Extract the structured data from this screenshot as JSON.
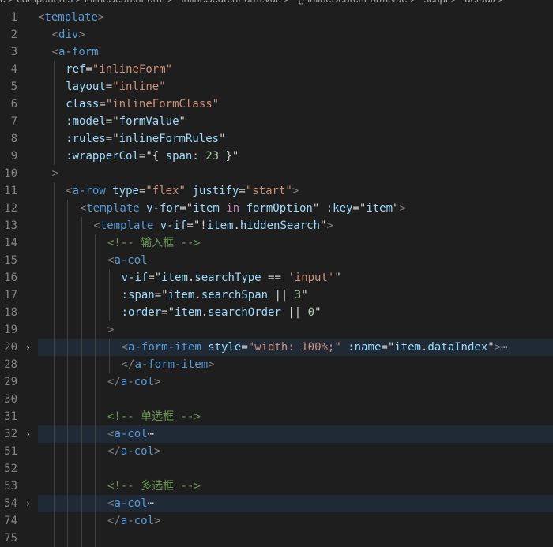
{
  "breadcrumb": [
    "c > components > inlineSearchForm > ",
    "inlineSearchForm.vue > ",
    "{} inlineSearchForm.vue > ",
    "script > ",
    "default > "
  ],
  "lines": [
    {
      "n": "1",
      "indent": 0,
      "fold": "",
      "hl": false,
      "tokens": [
        [
          "t",
          "<"
        ],
        [
          "tag",
          "template"
        ],
        [
          "t",
          ">"
        ]
      ]
    },
    {
      "n": "2",
      "indent": 1,
      "fold": "",
      "hl": false,
      "tokens": [
        [
          "t",
          "<"
        ],
        [
          "tag",
          "div"
        ],
        [
          "t",
          ">"
        ]
      ]
    },
    {
      "n": "3",
      "indent": 1,
      "fold": "",
      "hl": false,
      "tokens": [
        [
          "t",
          "<"
        ],
        [
          "tag",
          "a-form"
        ]
      ]
    },
    {
      "n": "4",
      "indent": 2,
      "fold": "",
      "hl": false,
      "tokens": [
        [
          "attr",
          "ref"
        ],
        [
          "d",
          "="
        ],
        [
          "str",
          "\"inlineForm\""
        ]
      ]
    },
    {
      "n": "5",
      "indent": 2,
      "fold": "",
      "hl": false,
      "tokens": [
        [
          "attr",
          "layout"
        ],
        [
          "d",
          "="
        ],
        [
          "str",
          "\"inline\""
        ]
      ]
    },
    {
      "n": "6",
      "indent": 2,
      "fold": "",
      "hl": false,
      "tokens": [
        [
          "attr",
          "class"
        ],
        [
          "d",
          "="
        ],
        [
          "str",
          "\"inlineFormClass\""
        ]
      ]
    },
    {
      "n": "7",
      "indent": 2,
      "fold": "",
      "hl": false,
      "tokens": [
        [
          "attr",
          ":model"
        ],
        [
          "d",
          "="
        ],
        [
          "d",
          "\""
        ],
        [
          "attr",
          "formValue"
        ],
        [
          "d",
          "\""
        ]
      ]
    },
    {
      "n": "8",
      "indent": 2,
      "fold": "",
      "hl": false,
      "tokens": [
        [
          "attr",
          ":rules"
        ],
        [
          "d",
          "="
        ],
        [
          "d",
          "\""
        ],
        [
          "attr",
          "inlineFormRules"
        ],
        [
          "d",
          "\""
        ]
      ]
    },
    {
      "n": "9",
      "indent": 2,
      "fold": "",
      "hl": false,
      "tokens": [
        [
          "attr",
          ":wrapperCol"
        ],
        [
          "d",
          "="
        ],
        [
          "d",
          "\"{ "
        ],
        [
          "attr",
          "span"
        ],
        [
          "d",
          ": "
        ],
        [
          "num",
          "23"
        ],
        [
          "d",
          " }\""
        ]
      ]
    },
    {
      "n": "10",
      "indent": 1,
      "fold": "",
      "hl": false,
      "tokens": [
        [
          "t",
          ">"
        ]
      ]
    },
    {
      "n": "11",
      "indent": 2,
      "fold": "",
      "hl": false,
      "tokens": [
        [
          "t",
          "<"
        ],
        [
          "tag",
          "a-row"
        ],
        [
          "d",
          " "
        ],
        [
          "attr",
          "type"
        ],
        [
          "d",
          "="
        ],
        [
          "str",
          "\"flex\""
        ],
        [
          "d",
          " "
        ],
        [
          "attr",
          "justify"
        ],
        [
          "d",
          "="
        ],
        [
          "str",
          "\"start\""
        ],
        [
          "t",
          ">"
        ]
      ]
    },
    {
      "n": "12",
      "indent": 3,
      "fold": "",
      "hl": false,
      "tokens": [
        [
          "t",
          "<"
        ],
        [
          "tag",
          "template"
        ],
        [
          "d",
          " "
        ],
        [
          "attr",
          "v-for"
        ],
        [
          "d",
          "=\""
        ],
        [
          "attr",
          "item"
        ],
        [
          "d",
          " "
        ],
        [
          "kw",
          "in"
        ],
        [
          "d",
          " "
        ],
        [
          "attr",
          "formOption"
        ],
        [
          "d",
          "\" "
        ],
        [
          "attr",
          ":key"
        ],
        [
          "d",
          "=\""
        ],
        [
          "attr",
          "item"
        ],
        [
          "d",
          "\""
        ],
        [
          "t",
          ">"
        ]
      ]
    },
    {
      "n": "13",
      "indent": 4,
      "fold": "",
      "hl": false,
      "tokens": [
        [
          "t",
          "<"
        ],
        [
          "tag",
          "template"
        ],
        [
          "d",
          " "
        ],
        [
          "attr",
          "v-if"
        ],
        [
          "d",
          "=\"!"
        ],
        [
          "attr",
          "item"
        ],
        [
          "d",
          "."
        ],
        [
          "attr",
          "hiddenSearch"
        ],
        [
          "d",
          "\""
        ],
        [
          "t",
          ">"
        ]
      ]
    },
    {
      "n": "14",
      "indent": 5,
      "fold": "",
      "hl": false,
      "tokens": [
        [
          "cm",
          "<!-- 输入框 -->"
        ]
      ]
    },
    {
      "n": "15",
      "indent": 5,
      "fold": "",
      "hl": false,
      "tokens": [
        [
          "t",
          "<"
        ],
        [
          "tag",
          "a-col"
        ]
      ]
    },
    {
      "n": "16",
      "indent": 6,
      "fold": "",
      "hl": false,
      "tokens": [
        [
          "attr",
          "v-if"
        ],
        [
          "d",
          "=\""
        ],
        [
          "attr",
          "item"
        ],
        [
          "d",
          "."
        ],
        [
          "attr",
          "searchType"
        ],
        [
          "d",
          " == "
        ],
        [
          "str",
          "'input'"
        ],
        [
          "d",
          "\""
        ]
      ]
    },
    {
      "n": "17",
      "indent": 6,
      "fold": "",
      "hl": false,
      "tokens": [
        [
          "attr",
          ":span"
        ],
        [
          "d",
          "=\""
        ],
        [
          "attr",
          "item"
        ],
        [
          "d",
          "."
        ],
        [
          "attr",
          "searchSpan"
        ],
        [
          "d",
          " || "
        ],
        [
          "num",
          "3"
        ],
        [
          "d",
          "\""
        ]
      ]
    },
    {
      "n": "18",
      "indent": 6,
      "fold": "",
      "hl": false,
      "tokens": [
        [
          "attr",
          ":order"
        ],
        [
          "d",
          "=\""
        ],
        [
          "attr",
          "item"
        ],
        [
          "d",
          "."
        ],
        [
          "attr",
          "searchOrder"
        ],
        [
          "d",
          " || "
        ],
        [
          "num",
          "0"
        ],
        [
          "d",
          "\""
        ]
      ]
    },
    {
      "n": "19",
      "indent": 5,
      "fold": "",
      "hl": false,
      "tokens": [
        [
          "t",
          ">"
        ]
      ]
    },
    {
      "n": "20",
      "indent": 6,
      "fold": "›",
      "hl": true,
      "tokens": [
        [
          "t",
          "<"
        ],
        [
          "tag",
          "a-form-item"
        ],
        [
          "d",
          " "
        ],
        [
          "attr",
          "style"
        ],
        [
          "d",
          "="
        ],
        [
          "str",
          "\"width: 100%;\""
        ],
        [
          "d",
          " "
        ],
        [
          "attr",
          ":name"
        ],
        [
          "d",
          "=\""
        ],
        [
          "attr",
          "item"
        ],
        [
          "d",
          "."
        ],
        [
          "attr",
          "dataIndex"
        ],
        [
          "d",
          "\""
        ],
        [
          "t",
          ">"
        ],
        [
          "ell",
          "⋯"
        ]
      ]
    },
    {
      "n": "28",
      "indent": 6,
      "fold": "",
      "hl": false,
      "tokens": [
        [
          "t",
          "</"
        ],
        [
          "tag",
          "a-form-item"
        ],
        [
          "t",
          ">"
        ]
      ]
    },
    {
      "n": "29",
      "indent": 5,
      "fold": "",
      "hl": false,
      "tokens": [
        [
          "t",
          "</"
        ],
        [
          "tag",
          "a-col"
        ],
        [
          "t",
          ">"
        ]
      ]
    },
    {
      "n": "30",
      "indent": 5,
      "fold": "",
      "hl": false,
      "tokens": []
    },
    {
      "n": "31",
      "indent": 5,
      "fold": "",
      "hl": false,
      "tokens": [
        [
          "cm",
          "<!-- 单选框 -->"
        ]
      ]
    },
    {
      "n": "32",
      "indent": 5,
      "fold": "›",
      "hl": true,
      "tokens": [
        [
          "t",
          "<"
        ],
        [
          "tag",
          "a-col"
        ],
        [
          "ell",
          "⋯"
        ]
      ]
    },
    {
      "n": "51",
      "indent": 5,
      "fold": "",
      "hl": false,
      "tokens": [
        [
          "t",
          "</"
        ],
        [
          "tag",
          "a-col"
        ],
        [
          "t",
          ">"
        ]
      ]
    },
    {
      "n": "52",
      "indent": 5,
      "fold": "",
      "hl": false,
      "tokens": []
    },
    {
      "n": "53",
      "indent": 5,
      "fold": "",
      "hl": false,
      "tokens": [
        [
          "cm",
          "<!-- 多选框 -->"
        ]
      ]
    },
    {
      "n": "54",
      "indent": 5,
      "fold": "›",
      "hl": true,
      "tokens": [
        [
          "t",
          "<"
        ],
        [
          "tag",
          "a-col"
        ],
        [
          "ell",
          "⋯"
        ]
      ]
    },
    {
      "n": "74",
      "indent": 5,
      "fold": "",
      "hl": false,
      "tokens": [
        [
          "t",
          "</"
        ],
        [
          "tag",
          "a-col"
        ],
        [
          "t",
          ">"
        ]
      ]
    },
    {
      "n": "75",
      "indent": 5,
      "fold": "",
      "hl": false,
      "tokens": []
    }
  ]
}
